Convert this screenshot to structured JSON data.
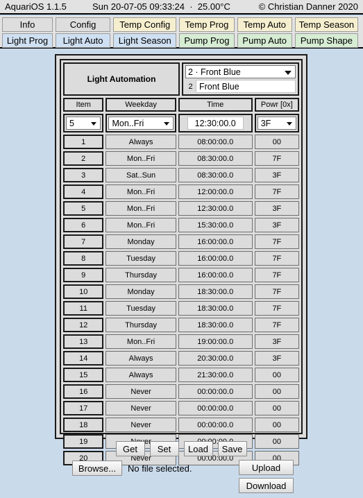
{
  "titlebar": {
    "app": "AquariOS 1.1.5",
    "datetime": "Sun 20-07-05 09:33:24  ·  25.00°C",
    "copyright": "© Christian Danner 2020"
  },
  "nav": {
    "row1": [
      {
        "label": "Info",
        "color": "gray",
        "width": "w1"
      },
      {
        "label": "Config",
        "color": "gray",
        "width": "w2"
      },
      {
        "label": "Temp Config",
        "color": "yellow",
        "width": "w3"
      },
      {
        "label": "Temp Prog",
        "color": "yellow",
        "width": "w2"
      },
      {
        "label": "Temp Auto",
        "color": "yellow",
        "width": "w2"
      },
      {
        "label": "Temp Season",
        "color": "yellow",
        "width": "w3"
      }
    ],
    "row2": [
      {
        "label": "Light Prog",
        "color": "blue",
        "width": "w1"
      },
      {
        "label": "Light Auto",
        "color": "blue",
        "width": "w2"
      },
      {
        "label": "Light Season",
        "color": "blue",
        "width": "w3"
      },
      {
        "label": "Pump Prog",
        "color": "green",
        "width": "w2"
      },
      {
        "label": "Pump Auto",
        "color": "green",
        "width": "w2"
      },
      {
        "label": "Pump Shape",
        "color": "green",
        "width": "w3"
      }
    ]
  },
  "panel": {
    "title": "Light Automation",
    "channel_select": "2 · Front Blue",
    "channel_index": "2",
    "channel_name": "Front Blue"
  },
  "table": {
    "headers": {
      "item": "Item",
      "weekday": "Weekday",
      "time": "Time",
      "power": "Powr [0x]"
    },
    "edit": {
      "item": "5",
      "weekday": "Mon..Fri",
      "time": "12:30:00.0",
      "power": "3F"
    },
    "rows": [
      {
        "item": "1",
        "weekday": "Always",
        "time": "08:00:00.0",
        "power": "00"
      },
      {
        "item": "2",
        "weekday": "Mon..Fri",
        "time": "08:30:00.0",
        "power": "7F"
      },
      {
        "item": "3",
        "weekday": "Sat..Sun",
        "time": "08:30:00.0",
        "power": "3F"
      },
      {
        "item": "4",
        "weekday": "Mon..Fri",
        "time": "12:00:00.0",
        "power": "7F"
      },
      {
        "item": "5",
        "weekday": "Mon..Fri",
        "time": "12:30:00.0",
        "power": "3F"
      },
      {
        "item": "6",
        "weekday": "Mon..Fri",
        "time": "15:30:00.0",
        "power": "3F"
      },
      {
        "item": "7",
        "weekday": "Monday",
        "time": "16:00:00.0",
        "power": "7F"
      },
      {
        "item": "8",
        "weekday": "Tuesday",
        "time": "16:00:00.0",
        "power": "7F"
      },
      {
        "item": "9",
        "weekday": "Thursday",
        "time": "16:00:00.0",
        "power": "7F"
      },
      {
        "item": "10",
        "weekday": "Monday",
        "time": "18:30:00.0",
        "power": "7F"
      },
      {
        "item": "11",
        "weekday": "Tuesday",
        "time": "18:30:00.0",
        "power": "7F"
      },
      {
        "item": "12",
        "weekday": "Thursday",
        "time": "18:30:00.0",
        "power": "7F"
      },
      {
        "item": "13",
        "weekday": "Mon..Fri",
        "time": "19:00:00.0",
        "power": "3F"
      },
      {
        "item": "14",
        "weekday": "Always",
        "time": "20:30:00.0",
        "power": "3F"
      },
      {
        "item": "15",
        "weekday": "Always",
        "time": "21:30:00.0",
        "power": "00"
      },
      {
        "item": "16",
        "weekday": "Never",
        "time": "00:00:00.0",
        "power": "00"
      },
      {
        "item": "17",
        "weekday": "Never",
        "time": "00:00:00.0",
        "power": "00"
      },
      {
        "item": "18",
        "weekday": "Never",
        "time": "00:00:00.0",
        "power": "00"
      },
      {
        "item": "19",
        "weekday": "Never",
        "time": "00:00:00.0",
        "power": "00"
      },
      {
        "item": "20",
        "weekday": "Never",
        "time": "00:00:00.0",
        "power": "00"
      }
    ]
  },
  "actions": {
    "get": "Get",
    "set": "Set",
    "load": "Load",
    "save": "Save",
    "browse": "Browse...",
    "file_status": "No file selected.",
    "upload": "Upload",
    "download": "Download"
  },
  "colors": {
    "page_bg": "#c9daeb",
    "panel_bg": "#dcdcdc",
    "tab_gray": "#dedede",
    "tab_blue": "#cfe0f2",
    "tab_yellow": "#f6efcf",
    "tab_green": "#d6edd4"
  }
}
